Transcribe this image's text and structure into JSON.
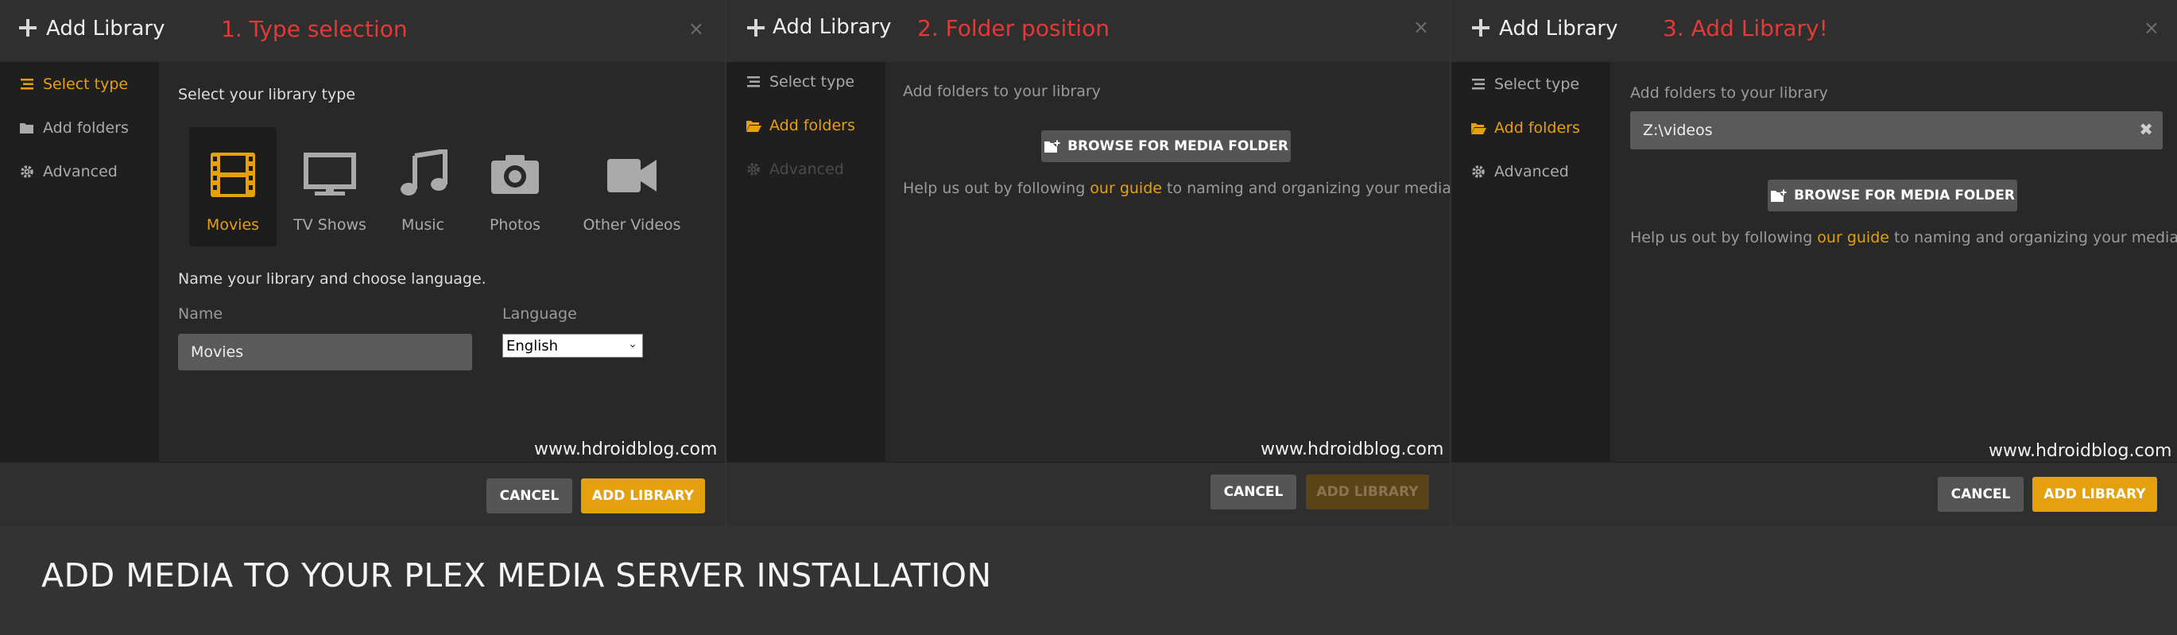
{
  "panels": [
    {
      "title": "Add Library",
      "step": "1. Type selection",
      "close": "×",
      "sidebar": [
        "Select type",
        "Add folders",
        "Advanced"
      ],
      "prompt": "Select your library type",
      "types": [
        "Movies",
        "TV Shows",
        "Music",
        "Photos",
        "Other Videos"
      ],
      "name_section": "Name your library and choose language.",
      "name_label": "Name",
      "name_value": "Movies",
      "language_label": "Language",
      "language_value": "English",
      "watermark": "www.hdroidblog.com",
      "cancel": "CANCEL",
      "add": "ADD LIBRARY"
    },
    {
      "title": "Add Library",
      "step": "2. Folder position",
      "close": "×",
      "sidebar": [
        "Select type",
        "Add folders",
        "Advanced"
      ],
      "prompt": "Add folders to your library",
      "browse": "BROWSE FOR MEDIA FOLDER",
      "help_pre": "Help us out by following ",
      "help_link": "our guide",
      "help_post": " to naming and organizing your media.",
      "watermark": "www.hdroidblog.com",
      "cancel": "CANCEL",
      "add": "ADD LIBRARY"
    },
    {
      "title": "Add Library",
      "step": "3. Add Library!",
      "close": "×",
      "sidebar": [
        "Select type",
        "Add folders",
        "Advanced"
      ],
      "prompt": "Add folders to your library",
      "folder_value": "Z:\\videos",
      "folder_remove": "✖",
      "browse": "BROWSE FOR MEDIA FOLDER",
      "help_pre": "Help us out by following ",
      "help_link": "our guide",
      "help_post": " to naming and organizing your media.",
      "watermark": "www.hdroidblog.com",
      "cancel": "CANCEL",
      "add": "ADD LIBRARY"
    }
  ],
  "bottom_title": "ADD MEDIA TO YOUR PLEX MEDIA SERVER INSTALLATION",
  "colors": {
    "accent": "#e5a00d",
    "step_red": "#e53935",
    "panel_bg": "#282828",
    "sidebar_bg": "#1f1f1f",
    "page_bg": "#333333"
  }
}
